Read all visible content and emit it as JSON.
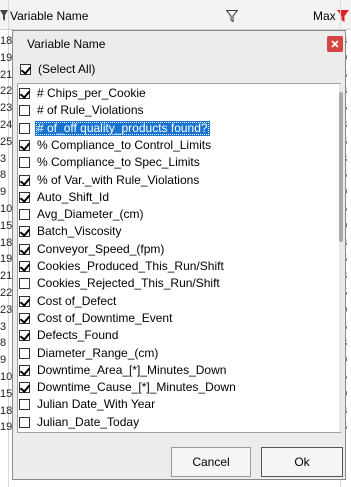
{
  "grid": {
    "col_variable_name": "Variable Name",
    "col_max": "Max",
    "left_values": [
      "18",
      "19",
      "21",
      "22",
      "23",
      "24",
      "25",
      "3",
      "8",
      "9",
      "10",
      "15",
      "18",
      "19",
      "21",
      "22",
      "23",
      "3",
      "8",
      "9",
      "10",
      "15",
      "18",
      "19"
    ],
    "right_values": [
      "3",
      "0",
      "5",
      "3",
      "5",
      "3",
      "5",
      "3",
      "5",
      "0",
      "5",
      "0",
      "3",
      "5",
      "3",
      "5",
      "0",
      "5",
      "3",
      "0",
      "5",
      "0",
      "3",
      "5"
    ]
  },
  "dialog": {
    "title": "Variable Name",
    "close_label": "x",
    "select_all": {
      "label": "(Select All)",
      "checked": true
    },
    "items": [
      {
        "label": "# Chips_per_Cookie",
        "checked": true,
        "selected": false
      },
      {
        "label": "# of Rule_Violations",
        "checked": false,
        "selected": false
      },
      {
        "label": "# of_off quality_products found?",
        "checked": false,
        "selected": true
      },
      {
        "label": "% Compliance_to Control_Limits",
        "checked": true,
        "selected": false
      },
      {
        "label": "% Compliance_to Spec_Limits",
        "checked": false,
        "selected": false
      },
      {
        "label": "% of Var._with Rule_Violations",
        "checked": true,
        "selected": false
      },
      {
        "label": "Auto_Shift_Id",
        "checked": true,
        "selected": false
      },
      {
        "label": "Avg_Diameter_(cm)",
        "checked": false,
        "selected": false
      },
      {
        "label": "Batch_Viscosity",
        "checked": true,
        "selected": false
      },
      {
        "label": "Conveyor_Speed_(fpm)",
        "checked": true,
        "selected": false
      },
      {
        "label": "Cookies_Produced_This_Run/Shift",
        "checked": true,
        "selected": false
      },
      {
        "label": "Cookies_Rejected_This_Run/Shift",
        "checked": false,
        "selected": false
      },
      {
        "label": "Cost of_Defect",
        "checked": true,
        "selected": false
      },
      {
        "label": "Cost of_Downtime_Event",
        "checked": true,
        "selected": false
      },
      {
        "label": "Defects_Found",
        "checked": true,
        "selected": false
      },
      {
        "label": "Diameter_Range_(cm)",
        "checked": false,
        "selected": false
      },
      {
        "label": "Downtime_Area_[*]_Minutes_Down",
        "checked": true,
        "selected": false
      },
      {
        "label": "Downtime_Cause_[*]_Minutes_Down",
        "checked": true,
        "selected": false
      },
      {
        "label": "Julian Date_With Year",
        "checked": false,
        "selected": false
      },
      {
        "label": "Julian_Date_Today",
        "checked": false,
        "selected": false
      }
    ],
    "cancel_label": "Cancel",
    "ok_label": "Ok"
  },
  "colors": {
    "selection": "#1874d0",
    "close": "#d64541",
    "filter_active": "#e02020"
  }
}
